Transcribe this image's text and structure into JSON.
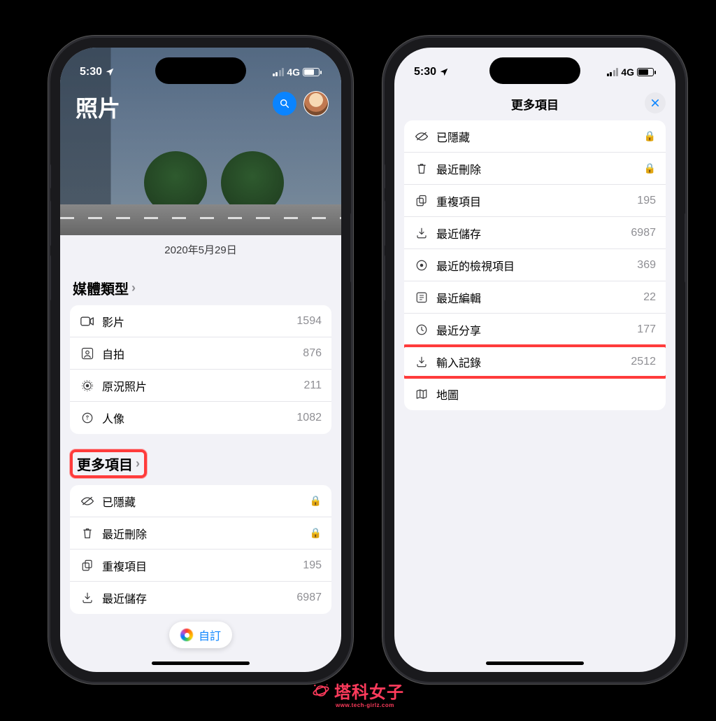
{
  "status": {
    "time": "5:30",
    "network": "4G"
  },
  "leftPhone": {
    "title": "照片",
    "heroDate": "2020年5月29日",
    "mediaSection": {
      "header": "媒體類型"
    },
    "mediaTypes": [
      {
        "icon": "video",
        "label": "影片",
        "count": "1594"
      },
      {
        "icon": "selfie",
        "label": "自拍",
        "count": "876"
      },
      {
        "icon": "live",
        "label": "原況照片",
        "count": "211"
      },
      {
        "icon": "portrait",
        "label": "人像",
        "count": "1082"
      }
    ],
    "moreSection": {
      "header": "更多項目"
    },
    "moreItems": [
      {
        "icon": "hidden",
        "label": "已隱藏",
        "locked": true
      },
      {
        "icon": "trash",
        "label": "最近刪除",
        "locked": true
      },
      {
        "icon": "duplicate",
        "label": "重複項目",
        "count": "195"
      },
      {
        "icon": "download",
        "label": "最近儲存",
        "count": "6987"
      }
    ],
    "customizeLabel": "自訂"
  },
  "rightPhone": {
    "modalTitle": "更多項目",
    "items": [
      {
        "icon": "hidden",
        "label": "已隱藏",
        "locked": true
      },
      {
        "icon": "trash",
        "label": "最近刪除",
        "locked": true
      },
      {
        "icon": "duplicate",
        "label": "重複項目",
        "count": "195"
      },
      {
        "icon": "download",
        "label": "最近儲存",
        "count": "6987"
      },
      {
        "icon": "recent-view",
        "label": "最近的檢視項目",
        "count": "369"
      },
      {
        "icon": "recent-edit",
        "label": "最近編輯",
        "count": "22"
      },
      {
        "icon": "recent-share",
        "label": "最近分享",
        "count": "177"
      },
      {
        "icon": "import",
        "label": "輸入記錄",
        "count": "2512",
        "highlight": true
      },
      {
        "icon": "map",
        "label": "地圖"
      }
    ]
  },
  "watermark": {
    "text": "塔科女子",
    "sub": "www.tech-girlz.com"
  }
}
